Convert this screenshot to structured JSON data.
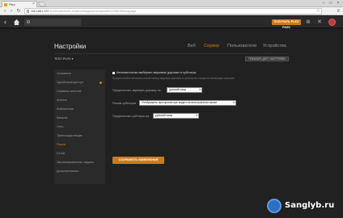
{
  "browser": {
    "tab_title": "Plex",
    "url_host": "192.168.1.137",
    "url_rest": ":32400/web/index.html#!/settings/server/abcdef0123456789/language",
    "close_glyph": "×",
    "back_glyph": "‹",
    "forward_glyph": "›",
    "reload_glyph": "↻",
    "star_glyph": "☆",
    "menu_glyph": "≡",
    "minimize_glyph": "–",
    "maximize_glyph": "□",
    "window_close_glyph": "×"
  },
  "plexbar": {
    "back_glyph": "‹",
    "premium_label": "ПОЛУЧИТЬ PLEX PASS",
    "cast_glyph": "⊚",
    "tools_glyph": "✕"
  },
  "page": {
    "title": "Настройки",
    "tabs": [
      {
        "label": "Веб",
        "active": false
      },
      {
        "label": "Сервер",
        "active": true
      },
      {
        "label": "Пользователи",
        "active": false
      },
      {
        "label": "Устройства",
        "active": false
      }
    ],
    "server_name": "TEST-PLEX ▾",
    "advanced_button": "ПОКАЗАТЬ ДОП. НАСТРОЙКИ"
  },
  "sidebar": {
    "items": [
      {
        "label": "Основные",
        "active": false,
        "badge": false
      },
      {
        "label": "Удалённый доступ",
        "active": false,
        "badge": true
      },
      {
        "label": "Сервисы агентов",
        "active": false,
        "badge": false
      },
      {
        "label": "Агенты",
        "active": false,
        "badge": false
      },
      {
        "label": "Библиотека",
        "active": false,
        "badge": false
      },
      {
        "label": "Каналы",
        "active": false,
        "badge": false
      },
      {
        "label": "Сеть",
        "active": false,
        "badge": false
      },
      {
        "label": "Транскодировщик",
        "active": false,
        "badge": false
      },
      {
        "label": "Языки",
        "active": true,
        "badge": false
      },
      {
        "label": "DLNA",
        "active": false,
        "badge": false
      },
      {
        "label": "Запланированные задачи",
        "active": false,
        "badge": false
      },
      {
        "label": "Дополнительно",
        "active": false,
        "badge": false
      }
    ]
  },
  "content": {
    "auto_select_label": "Автоматически выбирать звуковые дорожки и субтитры",
    "hint": "Предпочитайте автоматический выбор звуковых дорожек и субтитров с предпочтительными языками.",
    "audio_label": "Предпочитать звуковую дорожку на",
    "audio_value": "русский язык",
    "subtitle_mode_label": "Режим субтитров",
    "subtitle_mode_value": "Отображать при просмотре видео на иностранном языке",
    "subtitle_lang_label": "Предпочитать субтитры на",
    "subtitle_lang_value": "русский язык",
    "save_button": "СОХРАНИТЬ ИЗМЕНЕНИЯ"
  },
  "watermark": {
    "text": "Sanglyb.ru"
  },
  "colors": {
    "accent": "#cc7b19",
    "background": "#212121",
    "sidebar": "#2a2a2a"
  }
}
